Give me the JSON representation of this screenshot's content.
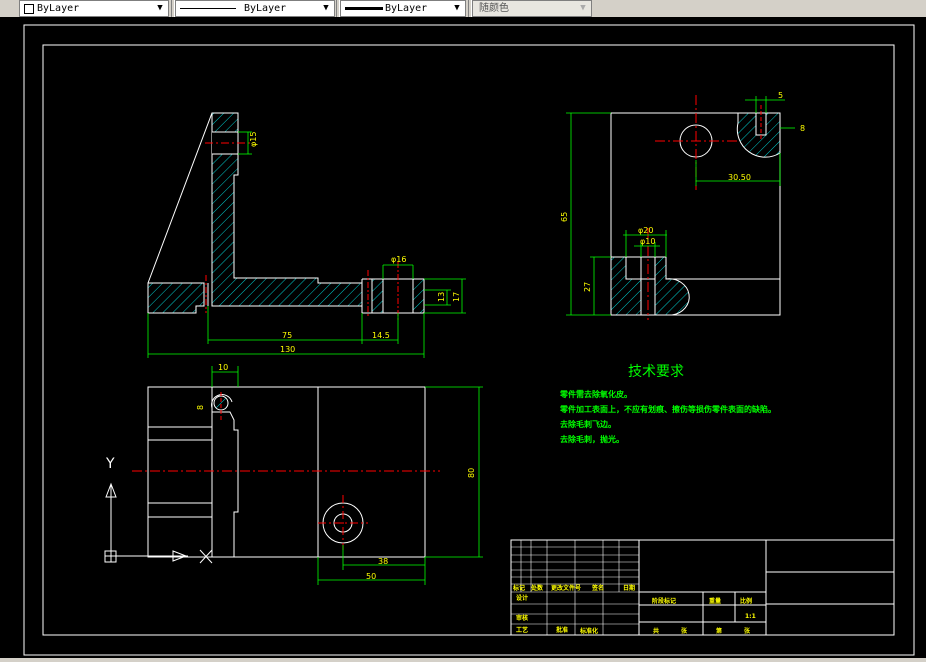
{
  "toolbar": {
    "layer_combo": "ByLayer",
    "linetype_combo": "ByLayer",
    "lineweight_combo": "ByLayer",
    "color_combo": "随颜色"
  },
  "drawing": {
    "dims_front": {
      "phi15": "φ15",
      "phi16": "φ16",
      "d75": "75",
      "d14_5": "14.5",
      "d130": "130",
      "d13": "13",
      "d17": "17"
    },
    "dims_top": {
      "d10": "10",
      "d8": "8",
      "d80": "80",
      "d38": "38",
      "d50": "50"
    },
    "dims_side": {
      "d65": "65",
      "d5": "5",
      "d8b": "8",
      "d30_50": "30.50",
      "phi20": "φ20",
      "phi10": "φ10",
      "d27": "27"
    },
    "ucs_y": "Y",
    "tech_title": "技术要求",
    "tech_notes": [
      "零件需去除氧化皮。",
      "零件加工表面上，不应有划痕、擦伤等损伤零件表面的缺陷。",
      "去除毛刺飞边。",
      "去除毛刺，抛光。"
    ],
    "title_block": {
      "mark": "标记",
      "count": "处数",
      "zone": "更改文件号",
      "sign": "签名",
      "date": "日期",
      "design": "设计",
      "std": "标准化",
      "stage": "阶段标记",
      "weight": "重量",
      "scale": "比例",
      "scale_val": "1:1",
      "review": "审核",
      "process": "工艺",
      "approve": "批准",
      "total": "共",
      "sheet": "张",
      "of": "第",
      "sheet2": "张"
    }
  }
}
